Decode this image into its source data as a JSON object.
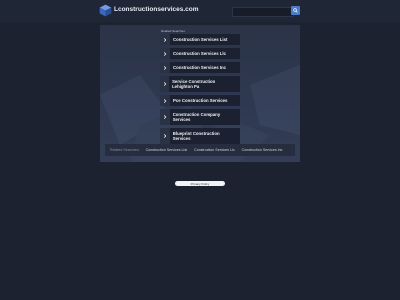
{
  "header": {
    "site_name": "Lconstructionservices.com",
    "search_placeholder": "",
    "logo_icon": "cube-logo-icon",
    "search_icon": "search-icon"
  },
  "panel": {
    "title": "Related Searches",
    "links": [
      {
        "label": "Construction Services List"
      },
      {
        "label": "Construction Services Llc"
      },
      {
        "label": "Construction Services Inc"
      },
      {
        "label": "Service Construction Lehighton Pa"
      },
      {
        "label": "Pce Construction Services"
      },
      {
        "label": "Construction Company Services"
      },
      {
        "label": "Blueprint Construction Services"
      }
    ]
  },
  "related": {
    "label": "Related Searches:",
    "links": [
      "Construction Services List",
      "Construction Services Llc",
      "Construction Services Inc"
    ]
  },
  "footer": {
    "privacy_label": "Privacy Policy"
  },
  "colors": {
    "background": "#1c2230",
    "accent": "#4a7bd0",
    "panel": "#2e3850"
  }
}
